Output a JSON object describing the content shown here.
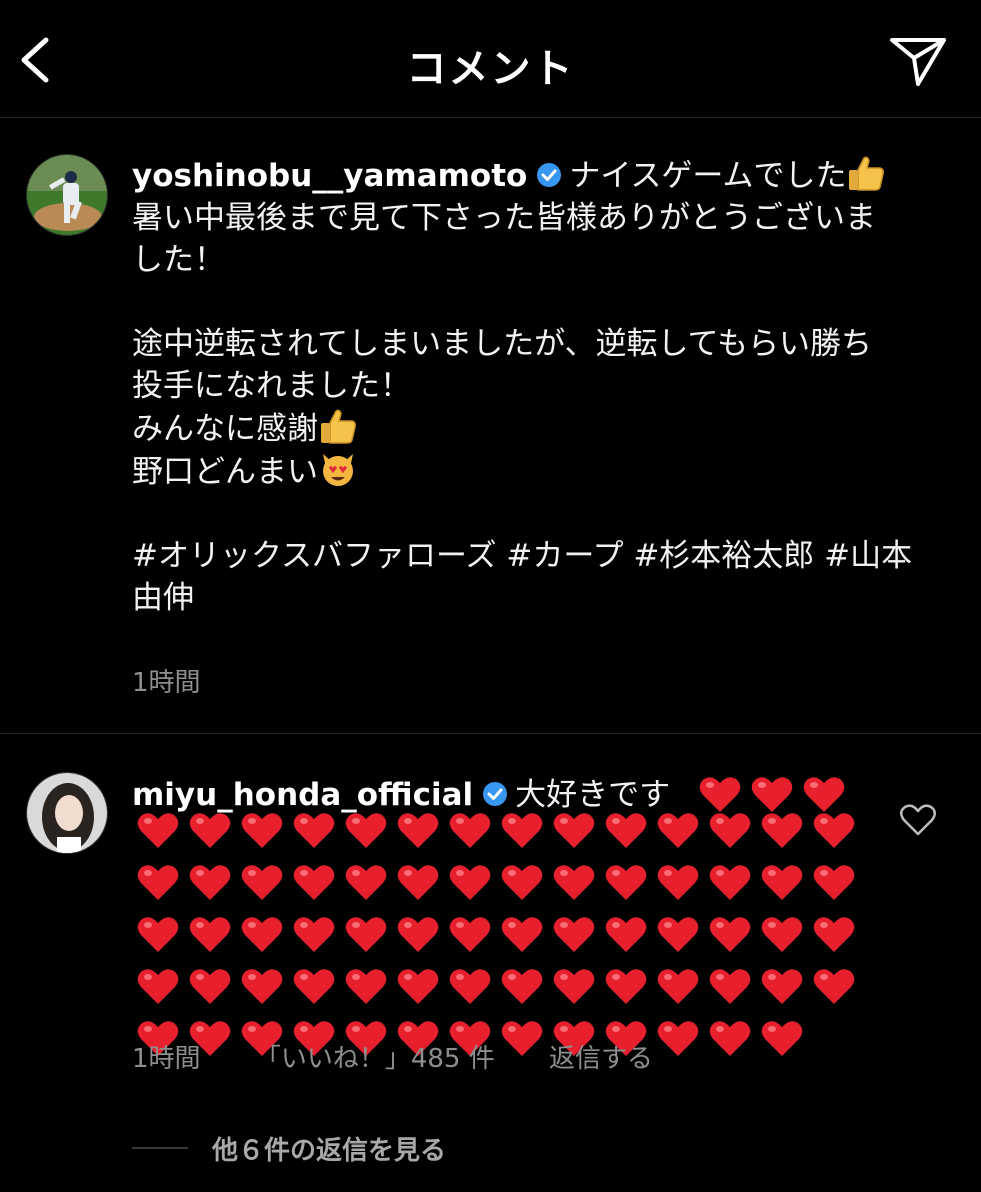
{
  "header": {
    "title": "コメント",
    "back_icon": "chevron-left-icon",
    "send_icon": "paper-plane-icon"
  },
  "caption": {
    "username": "yoshinobu__yamamoto",
    "text_first": "ナイスゲームでした",
    "lines": [
      "暑い中最後まで見て下さった皆様ありがとうございま",
      "した！",
      "",
      "途中逆転されてしまいましたが、逆転してもらい勝ち",
      "投手になれました！"
    ],
    "line_thanks": "みんなに感謝",
    "line_noguchi": "野口どんまい",
    "hashtags_line1": "#オリックスバファローズ #カープ #杉本裕太郎 #山本",
    "hashtags_line2": "由伸",
    "time": "1時間"
  },
  "reply": {
    "username": "miyu_honda_official",
    "text": "大好きです",
    "heart_rows": [
      3,
      14,
      14,
      14,
      14,
      13
    ],
    "time": "1時間",
    "likes": "「いいね！」485 件",
    "reply_action": "返信する",
    "view_replies": "他６件の返信を見る"
  },
  "colors": {
    "background": "#000000",
    "verified": "#3897f0",
    "heart": "#e8202e",
    "meta": "#8e8e8e"
  }
}
